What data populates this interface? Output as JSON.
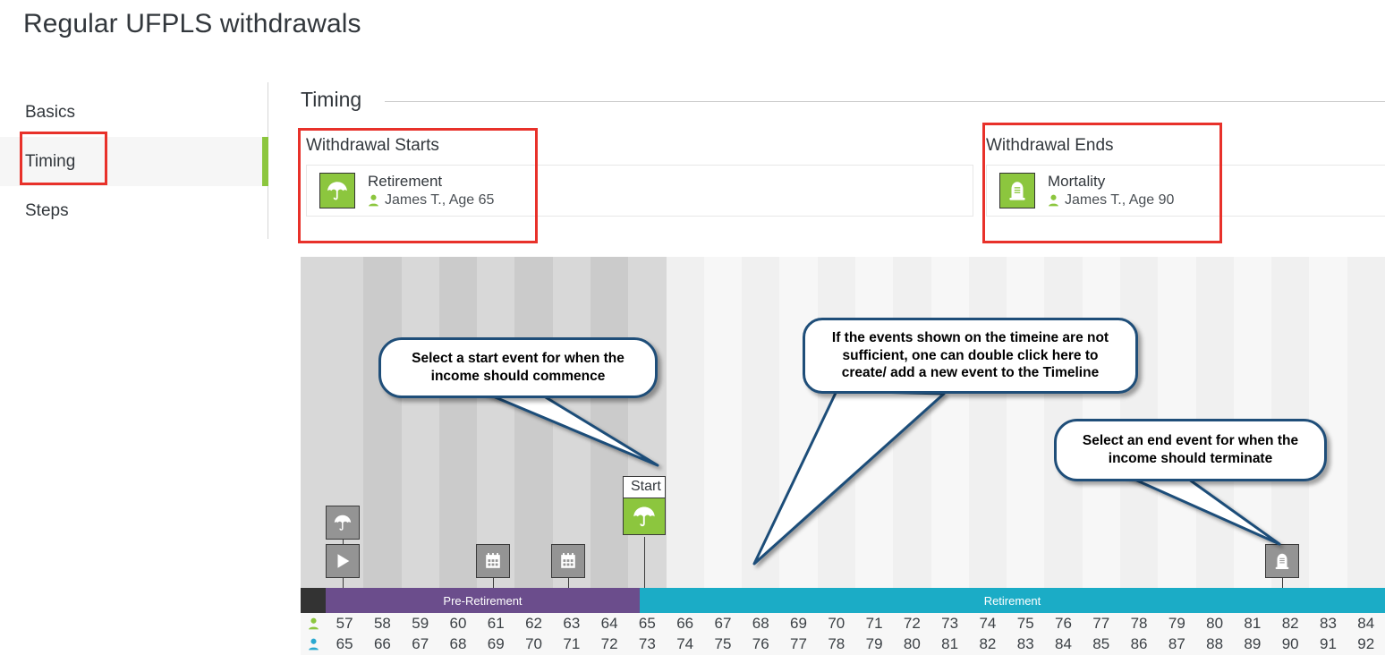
{
  "page": {
    "title": "Regular UFPLS withdrawals"
  },
  "sidebar": {
    "items": [
      {
        "label": "Basics",
        "active": false
      },
      {
        "label": "Timing",
        "active": true
      },
      {
        "label": "Steps",
        "active": false
      }
    ]
  },
  "section": {
    "title": "Timing"
  },
  "events": {
    "start": {
      "title": "Withdrawal Starts",
      "name": "Retirement",
      "person": "James T., Age 65",
      "icon": "umbrella-icon"
    },
    "end": {
      "title": "Withdrawal Ends",
      "name": "Mortality",
      "person": "James T., Age 90",
      "icon": "gravestone-icon"
    }
  },
  "callouts": [
    {
      "id": "start-callout",
      "text": "Select a start event for when the income should commence"
    },
    {
      "id": "create-event-callout",
      "text": "If the events shown on the timeine are not sufficient, one can double click here to create/ add a new event to the Timeline"
    },
    {
      "id": "end-callout",
      "text": "Select an end event for when the income should terminate"
    }
  ],
  "timeline": {
    "start_chip_label": "Start",
    "markers": [
      {
        "name": "umbrella-marker",
        "icon": "umbrella-icon",
        "col": 0
      },
      {
        "name": "play-marker",
        "icon": "play-icon",
        "col": 0
      },
      {
        "name": "calendar-marker-1",
        "icon": "calendar-icon",
        "col": 5
      },
      {
        "name": "calendar-marker-2",
        "icon": "calendar-icon",
        "col": 7
      },
      {
        "name": "mortality-marker",
        "icon": "gravestone-icon",
        "col": 26
      }
    ],
    "phases": [
      {
        "label": "",
        "color": "#333333",
        "span": 0.7
      },
      {
        "label": "Pre-Retirement",
        "color": "#6b4d8c",
        "span": 8.3
      },
      {
        "label": "Retirement",
        "color": "#1bacc6",
        "span": 19
      }
    ],
    "age_rows": [
      {
        "icon": "person-icon",
        "icon_color": "#8cc63e",
        "values": [
          57,
          58,
          59,
          60,
          61,
          62,
          63,
          64,
          65,
          66,
          67,
          68,
          69,
          70,
          71,
          72,
          73,
          74,
          75,
          76,
          77,
          78,
          79,
          80,
          81,
          82,
          83,
          84
        ]
      },
      {
        "icon": "person-icon",
        "icon_color": "#29a8d0",
        "values": [
          65,
          66,
          67,
          68,
          69,
          70,
          71,
          72,
          73,
          74,
          75,
          76,
          77,
          78,
          79,
          80,
          81,
          82,
          83,
          84,
          85,
          86,
          87,
          88,
          89,
          90,
          91,
          92
        ]
      }
    ]
  },
  "colors": {
    "accent_green": "#8cc63e",
    "highlight_red": "#e8312a",
    "pre_retirement": "#6b4d8c",
    "retirement": "#1bacc6",
    "callout_border": "#1f4e79"
  }
}
